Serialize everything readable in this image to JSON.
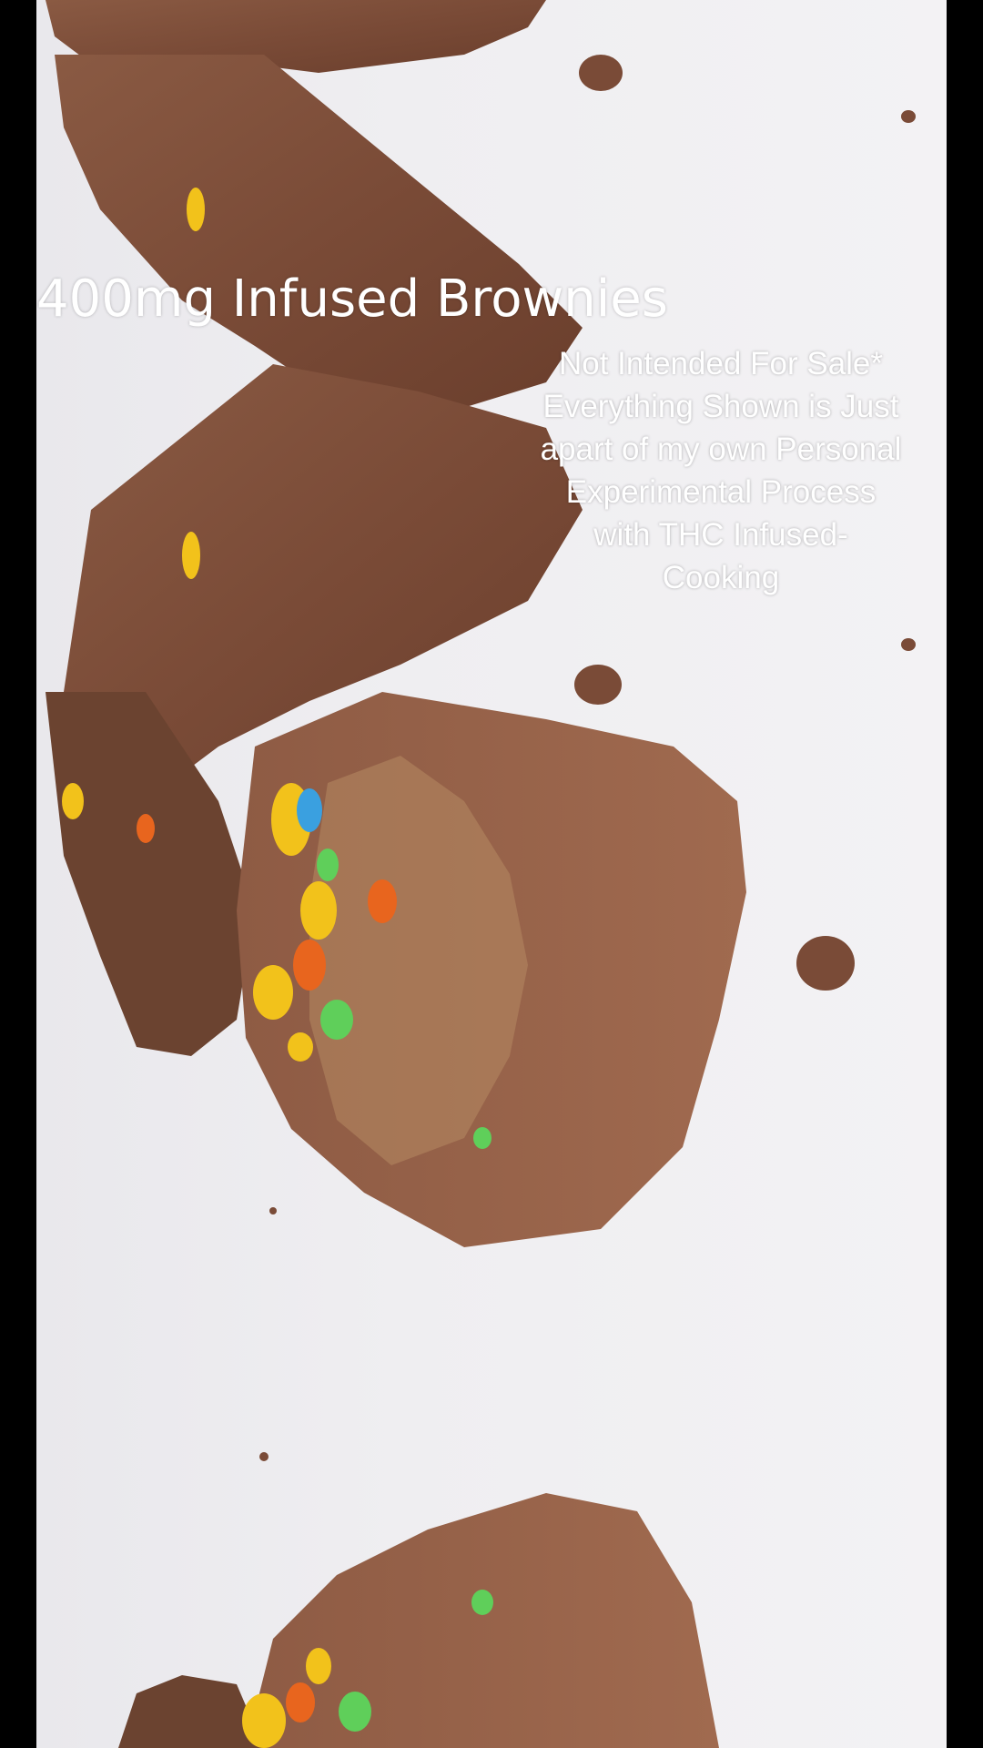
{
  "overlay": {
    "title": "400mg Infused Brownies",
    "disclaimer_lines": [
      "Not Intended For Sale*",
      "Everything Shown is Just",
      "apart of my own Personal",
      "Experimental Process",
      "with THC Infused-",
      "Cooking"
    ]
  },
  "colors": {
    "background_bars": "#000000",
    "surface": "#efeef1",
    "brownie": "#7a4b37",
    "brownie_dark": "#5a3324",
    "candy_yellow": "#f2c21b",
    "candy_green": "#5fcf5a",
    "candy_orange": "#e8651e",
    "candy_blue": "#3aa0e0",
    "text": "#ffffff"
  }
}
